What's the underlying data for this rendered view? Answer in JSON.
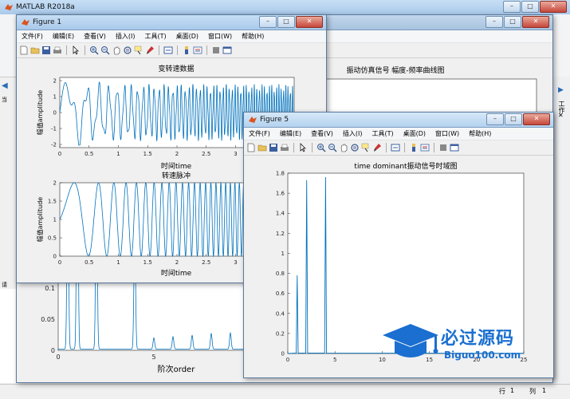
{
  "app": {
    "title": "MATLAB R2018a",
    "status_row_label": "行",
    "status_row_value": "1",
    "status_col_label": "列",
    "status_col_value": "1",
    "right_panel_label": "工作"
  },
  "menus": [
    "文件(F)",
    "编辑(E)",
    "查看(V)",
    "插入(I)",
    "工具(T)",
    "桌面(D)",
    "窗口(W)",
    "帮助(H)"
  ],
  "figure1": {
    "title": "Figure 1",
    "top_plot": {
      "title": "变转速数据",
      "xlabel": "时间time",
      "ylabel": "幅值amplitude",
      "yticks": [
        "2",
        "1",
        "0",
        "-1",
        "-2"
      ],
      "xticks": [
        "0",
        "0.5",
        "1",
        "1.5",
        "2",
        "2.5",
        "3",
        "3.5"
      ]
    },
    "bottom_plot": {
      "title": "转速脉冲",
      "xlabel": "时间time",
      "ylabel": "幅值amplitude",
      "yticks": [
        "2",
        "1.5",
        "1",
        "0.5",
        "0"
      ],
      "xticks": [
        "0",
        "0.5",
        "1",
        "1.5",
        "2",
        "2.5",
        "3",
        "3.5"
      ]
    }
  },
  "figure_back": {
    "title": "振动仿真信号 幅度-频率曲线图",
    "ylabel_visible": [
      "0.1",
      "0.05",
      "0"
    ],
    "xticks": [
      "0",
      "5",
      "10",
      "15",
      "20"
    ],
    "xlabel": "阶次order"
  },
  "figure5": {
    "title": "Figure 5",
    "plot_title": "time dominant振动信号时域图",
    "yticks": [
      "1.8",
      "1.6",
      "1.4",
      "1.2",
      "1",
      "0.8",
      "0.6",
      "0.4",
      "0.2",
      "0"
    ],
    "xticks": [
      "0",
      "5",
      "10",
      "15",
      "20",
      "25"
    ]
  },
  "watermark": {
    "title": "必过源码",
    "subtitle": "Biguo100.com"
  },
  "chart_data": [
    {
      "type": "line",
      "title": "变转速数据",
      "xlabel": "时间time",
      "ylabel": "幅值amplitude",
      "xlim": [
        0,
        4
      ],
      "ylim": [
        -2.2,
        2.2
      ]
    },
    {
      "type": "line",
      "title": "转速脉冲",
      "xlabel": "时间time",
      "ylabel": "幅值amplitude",
      "xlim": [
        0,
        4
      ],
      "ylim": [
        0,
        2
      ]
    },
    {
      "type": "line",
      "title": "time dominant振动信号时域图",
      "xlim": [
        0,
        25
      ],
      "ylim": [
        0,
        1.8
      ],
      "peaks": [
        {
          "x": 1,
          "y": 0.78
        },
        {
          "x": 2,
          "y": 1.73
        },
        {
          "x": 4,
          "y": 1.76
        }
      ]
    }
  ],
  "colors": {
    "line": "#0072bd",
    "axes_bg": "#ffffff",
    "figure_bg": "#f0f0f0"
  }
}
